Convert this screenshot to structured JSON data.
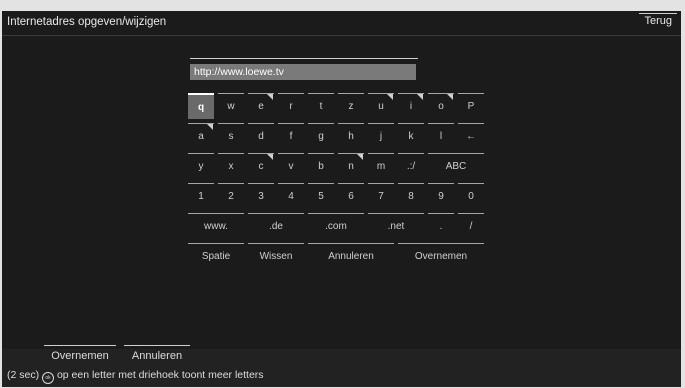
{
  "header": {
    "title": "Internetadres opgeven/wijzigen",
    "back_label": "Terug"
  },
  "url_input": {
    "value": "http://www.loewe.tv"
  },
  "keyboard": {
    "rows": [
      [
        {
          "label": "q",
          "tri": false,
          "focus": true
        },
        {
          "label": "w",
          "tri": false
        },
        {
          "label": "e",
          "tri": true
        },
        {
          "label": "r",
          "tri": false
        },
        {
          "label": "t",
          "tri": false
        },
        {
          "label": "z",
          "tri": false
        },
        {
          "label": "u",
          "tri": true
        },
        {
          "label": "i",
          "tri": true
        },
        {
          "label": "o",
          "tri": true
        },
        {
          "label": "P",
          "tri": false
        }
      ],
      [
        {
          "label": "a",
          "tri": true
        },
        {
          "label": "s",
          "tri": false
        },
        {
          "label": "d",
          "tri": false
        },
        {
          "label": "f",
          "tri": false
        },
        {
          "label": "g",
          "tri": false
        },
        {
          "label": "h",
          "tri": false
        },
        {
          "label": "j",
          "tri": false
        },
        {
          "label": "k",
          "tri": false
        },
        {
          "label": "l",
          "tri": false
        },
        {
          "label": "←",
          "tri": false
        }
      ],
      [
        {
          "label": "y",
          "tri": false
        },
        {
          "label": "x",
          "tri": false
        },
        {
          "label": "c",
          "tri": true
        },
        {
          "label": "v",
          "tri": false
        },
        {
          "label": "b",
          "tri": false
        },
        {
          "label": "n",
          "tri": true
        },
        {
          "label": "m",
          "tri": false
        },
        {
          "label": ".:/",
          "tri": false
        },
        {
          "label": "ABC",
          "tri": false,
          "wide": 2
        }
      ],
      [
        {
          "label": "1",
          "tri": false
        },
        {
          "label": "2",
          "tri": false
        },
        {
          "label": "3",
          "tri": false
        },
        {
          "label": "4",
          "tri": false
        },
        {
          "label": "5",
          "tri": false
        },
        {
          "label": "6",
          "tri": false
        },
        {
          "label": "7",
          "tri": false
        },
        {
          "label": "8",
          "tri": false
        },
        {
          "label": "9",
          "tri": false
        },
        {
          "label": "0",
          "tri": false
        }
      ],
      [
        {
          "label": "www.",
          "tri": false,
          "wide": 2
        },
        {
          "label": ".de",
          "tri": false,
          "wide": 2
        },
        {
          "label": ".com",
          "tri": false,
          "wide": 2
        },
        {
          "label": ".net",
          "tri": false,
          "wide": 2
        },
        {
          "label": ".",
          "tri": false
        },
        {
          "label": "/",
          "tri": false
        }
      ],
      [
        {
          "label": "Spatie",
          "tri": false,
          "wide": 2
        },
        {
          "label": "Wissen",
          "tri": false,
          "wide": 2
        },
        {
          "label": "Annuleren",
          "tri": false,
          "wide": 3
        },
        {
          "label": "Overnemen",
          "tri": false,
          "wide": 3
        }
      ]
    ]
  },
  "footer": {
    "accept_label": "Overnemen",
    "cancel_label": "Annuleren",
    "hint_prefix": "(2 sec)",
    "hint_icon": "ok-icon",
    "hint_icon_text": "ok",
    "hint_suffix": "op een letter met driehoek toont meer letters"
  }
}
